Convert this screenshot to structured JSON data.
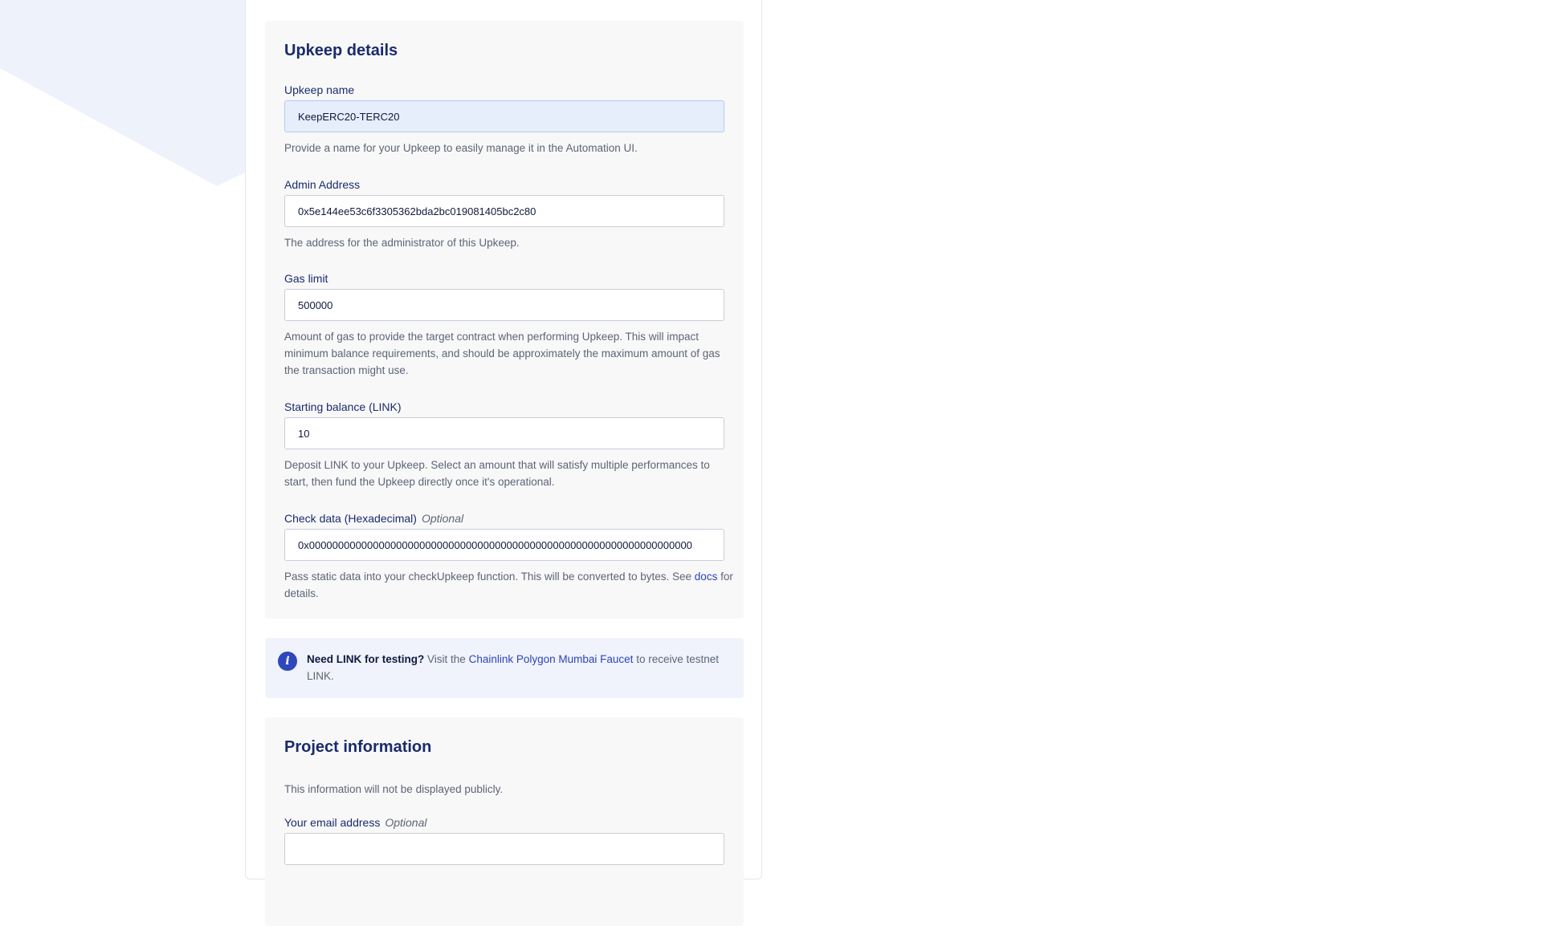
{
  "upkeep": {
    "title": "Upkeep details",
    "name": {
      "label": "Upkeep name",
      "value": "KeepERC20-TERC20",
      "help": "Provide a name for your Upkeep to easily manage it in the Automation UI."
    },
    "admin": {
      "label": "Admin Address",
      "value": "0x5e144ee53c6f3305362bda2bc019081405bc2c80",
      "help": "The address for the administrator of this Upkeep."
    },
    "gas": {
      "label": "Gas limit",
      "value": "500000",
      "help": "Amount of gas to provide the target contract when performing Upkeep. This will impact minimum balance requirements, and should be approximately the maximum amount of gas the transaction might use."
    },
    "balance": {
      "label": "Starting balance (LINK)",
      "value": "10",
      "help": "Deposit LINK to your Upkeep. Select an amount that will satisfy multiple performances to start, then fund the Upkeep directly once it's operational."
    },
    "checkdata": {
      "label": "Check data (Hexadecimal)",
      "optional": "Optional",
      "value": "0x000000000000000000000000000000000000000000000000000000000000000000",
      "help_before": "Pass static data into your checkUpkeep function. This will be converted to bytes. See",
      "help_link": "docs",
      "help_after": "for details."
    }
  },
  "info": {
    "icon": "info-icon",
    "bold": "Need LINK for testing?",
    "before": "Visit the",
    "link": "Chainlink Polygon Mumbai Faucet",
    "after": "to receive testnet LINK."
  },
  "project": {
    "title": "Project information",
    "description": "This information will not be displayed publicly.",
    "email": {
      "label": "Your email address",
      "optional": "Optional",
      "value": ""
    }
  },
  "colors": {
    "navy": "#1a2b6b",
    "accent": "#2e47bd",
    "background_shape": "#eef2fb"
  }
}
